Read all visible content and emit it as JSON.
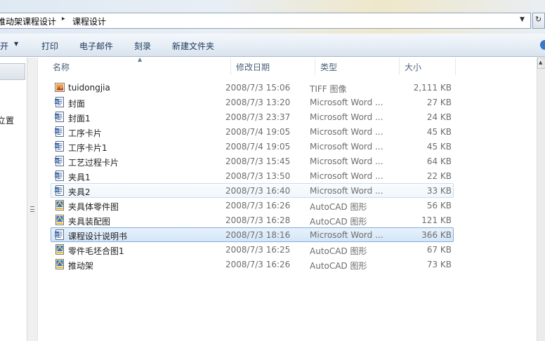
{
  "address": {
    "crumbs": [
      "推动架课程设计",
      "课程设计"
    ],
    "separator": "▸",
    "dropdown_glyph": "▼",
    "refresh_glyph": "↻"
  },
  "toolbar": {
    "open_label": "开",
    "open_arrow": "▼",
    "print_label": "打印",
    "email_label": "电子邮件",
    "burn_label": "刻录",
    "new_folder_label": "新建文件夹"
  },
  "nav": {
    "partial_text_1": "立置",
    "partial_text_2": ")"
  },
  "columns": {
    "name": "名称",
    "date": "修改日期",
    "type": "类型",
    "size": "大小",
    "sort_glyph": "▲"
  },
  "files": [
    {
      "name": "tuidongjia",
      "date": "2008/7/3 15:06",
      "type": "TIFF 图像",
      "size": "2,111 KB",
      "icon": "tiff-image-icon"
    },
    {
      "name": "封面",
      "date": "2008/7/3 13:20",
      "type": "Microsoft Word ...",
      "size": "27 KB",
      "icon": "word-document-icon"
    },
    {
      "name": "封面1",
      "date": "2008/7/3 23:37",
      "type": "Microsoft Word ...",
      "size": "24 KB",
      "icon": "word-document-icon"
    },
    {
      "name": "工序卡片",
      "date": "2008/7/4 19:05",
      "type": "Microsoft Word ...",
      "size": "45 KB",
      "icon": "word-document-icon"
    },
    {
      "name": "工序卡片1",
      "date": "2008/7/4 19:05",
      "type": "Microsoft Word ...",
      "size": "45 KB",
      "icon": "word-document-icon"
    },
    {
      "name": "工艺过程卡片",
      "date": "2008/7/3 15:45",
      "type": "Microsoft Word ...",
      "size": "64 KB",
      "icon": "word-document-icon"
    },
    {
      "name": "夹具1",
      "date": "2008/7/3 13:50",
      "type": "Microsoft Word ...",
      "size": "22 KB",
      "icon": "word-document-icon"
    },
    {
      "name": "夹具2",
      "date": "2008/7/3 16:40",
      "type": "Microsoft Word ...",
      "size": "33 KB",
      "icon": "word-document-icon"
    },
    {
      "name": "夹具体零件图",
      "date": "2008/7/3 16:26",
      "type": "AutoCAD 图形",
      "size": "56 KB",
      "icon": "autocad-drawing-icon"
    },
    {
      "name": "夹具装配图",
      "date": "2008/7/3 16:28",
      "type": "AutoCAD 图形",
      "size": "121 KB",
      "icon": "autocad-drawing-icon"
    },
    {
      "name": "课程设计说明书",
      "date": "2008/7/3 18:16",
      "type": "Microsoft Word ...",
      "size": "366 KB",
      "icon": "word-document-icon"
    },
    {
      "name": "零件毛坯合图1",
      "date": "2008/7/3 16:25",
      "type": "AutoCAD 图形",
      "size": "67 KB",
      "icon": "autocad-drawing-icon"
    },
    {
      "name": "推动架",
      "date": "2008/7/3 16:26",
      "type": "AutoCAD 图形",
      "size": "73 KB",
      "icon": "autocad-drawing-icon"
    }
  ],
  "state": {
    "hover_row": "夹具2",
    "selected_row": "课程设计说明书"
  },
  "colors": {
    "selection_fill": "#d3e6f8",
    "selection_border": "#84acdd",
    "toolbar_text": "#1e395b",
    "header_text": "#4c607a"
  }
}
